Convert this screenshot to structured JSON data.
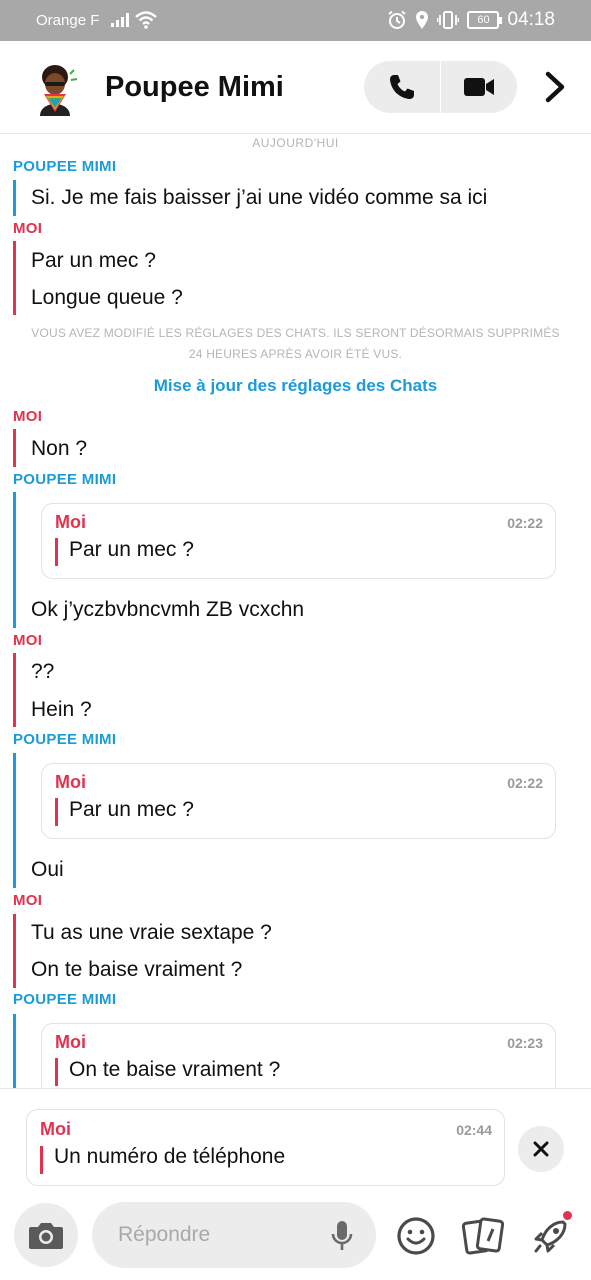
{
  "status_bar": {
    "carrier": "Orange F",
    "battery": "60",
    "time": "04:18"
  },
  "header": {
    "title": "Poupee Mimi",
    "icons": [
      "avatar",
      "phone-icon",
      "video-icon",
      "chevron-right-icon"
    ]
  },
  "chat": {
    "day_label": "AUJOURD'HUI",
    "notice_line1": "VOUS AVEZ MODIFIÉ LES RÉGLAGES DES CHATS. ILS SERONT DÉSORMAIS SUPPRIMÉS",
    "notice_line2": "24 HEURES APRÈS AVOIR ÉTÉ VUS.",
    "settings_link": "Mise à jour des réglages des Chats",
    "groups": [
      {
        "sender": "POUPEE MIMI",
        "messages": [
          "Si. Je me fais baisser j’ai une vidéo comme sa ici"
        ]
      },
      {
        "sender": "MOI",
        "messages": [
          "Par un mec ?",
          "Longue queue ?"
        ]
      },
      {
        "sender": "MOI",
        "messages": [
          "Non ?"
        ]
      },
      {
        "sender": "POUPEE MIMI",
        "quote": {
          "sender": "Moi",
          "time": "02:22",
          "text": "Par un mec ?"
        },
        "messages": [
          "Ok j’yczbvbncvmh  ZB vcxchn"
        ]
      },
      {
        "sender": "MOI",
        "messages": [
          " ??",
          "Hein ?"
        ]
      },
      {
        "sender": "POUPEE MIMI",
        "quote": {
          "sender": "Moi",
          "time": "02:22",
          "text": "Par un mec ?"
        },
        "messages": [
          "Oui"
        ]
      },
      {
        "sender": "MOI",
        "messages": [
          "Tu as une vraie sextape ?",
          "On te baise vraiment ?"
        ]
      },
      {
        "sender": "POUPEE MIMI",
        "quote": {
          "sender": "Moi",
          "time": "02:23",
          "text": "On te baise vraiment ?"
        },
        "messages": []
      }
    ]
  },
  "reply": {
    "quote": {
      "sender": "Moi",
      "time": "02:44",
      "text": "Un numéro de téléphone"
    },
    "placeholder": "Répondre",
    "icons": [
      "camera-icon",
      "microphone-icon",
      "smiley-icon",
      "cards-icon",
      "rocket-icon",
      "close-icon"
    ]
  },
  "colors": {
    "them": "#1b9bd8",
    "me": "#e0334e",
    "status_bar": "#a8a8a8",
    "bubble_bg": "#ececec"
  }
}
